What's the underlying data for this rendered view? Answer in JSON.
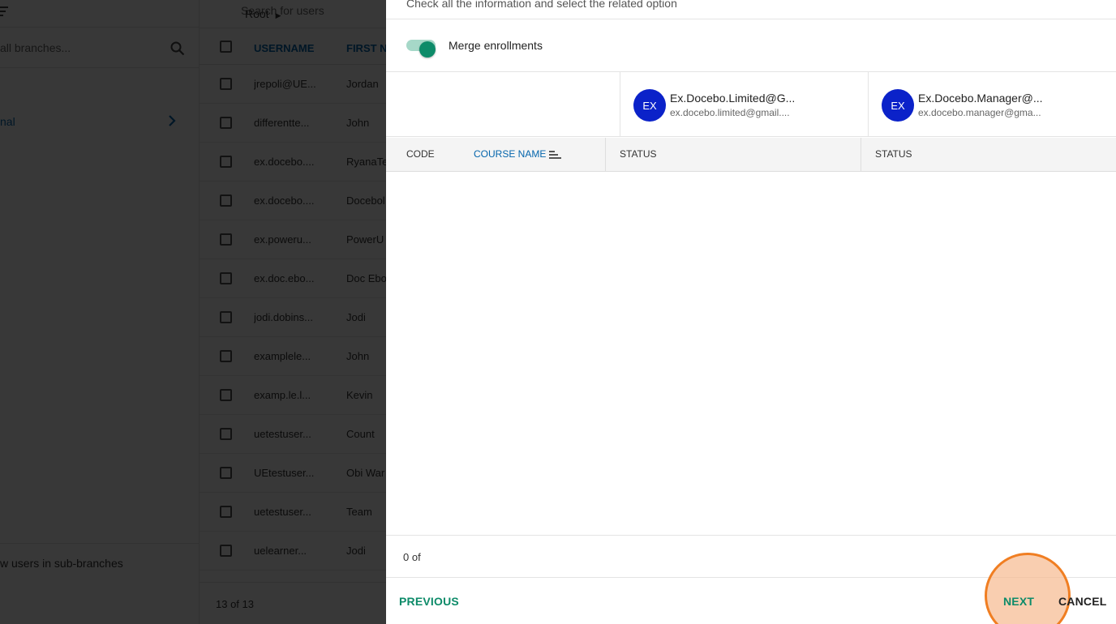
{
  "background": {
    "left_panel": {
      "search_placeholder": "all branches...",
      "branch_label": "nal",
      "show_subbranches_label": "w users in sub-branches"
    },
    "main_panel": {
      "search_placeholder": "Search for users",
      "breadcrumb": "Root",
      "columns": [
        "USERNAME",
        "FIRST N"
      ],
      "rows": [
        {
          "username": "jrepoli@UE...",
          "first_name": "Jordan"
        },
        {
          "username": "differentte...",
          "first_name": "John"
        },
        {
          "username": "ex.docebo....",
          "first_name": "RyanaTe"
        },
        {
          "username": "ex.docebo....",
          "first_name": "Docebol"
        },
        {
          "username": "ex.poweru...",
          "first_name": "PowerU"
        },
        {
          "username": "ex.doc.ebo...",
          "first_name": "Doc Ebo"
        },
        {
          "username": "jodi.dobins...",
          "first_name": "Jodi"
        },
        {
          "username": "examplele...",
          "first_name": "John"
        },
        {
          "username": "examp.le.l...",
          "first_name": "Kevin"
        },
        {
          "username": "uetestuser...",
          "first_name": "Count"
        },
        {
          "username": "UEtestuser...",
          "first_name": "Obi War"
        },
        {
          "username": "uetestuser...",
          "first_name": "Team"
        },
        {
          "username": "uelearner...",
          "first_name": "Jodi"
        }
      ],
      "footer_count": "13 of 13"
    }
  },
  "modal": {
    "instructions": "Check all the information and select the related option",
    "merge_toggle_label": "Merge enrollments",
    "merge_toggle_on": true,
    "users": [
      {
        "avatar": "EX",
        "name": "Ex.Docebo.Limited@G...",
        "email": "ex.docebo.limited@gmail...."
      },
      {
        "avatar": "EX",
        "name": "Ex.Docebo.Manager@...",
        "email": "ex.docebo.manager@gma..."
      }
    ],
    "table_headers": {
      "code": "CODE",
      "course_name": "COURSE NAME",
      "status_1": "STATUS",
      "status_2": "STATUS"
    },
    "pager_text": "0 of",
    "buttons": {
      "previous": "PREVIOUS",
      "next": "NEXT",
      "cancel": "CANCEL"
    }
  },
  "colors": {
    "accent_green": "#0d8b69",
    "link_blue": "#0465ac",
    "avatar_blue": "#0b22c9",
    "click_highlight": "#f07e22"
  }
}
